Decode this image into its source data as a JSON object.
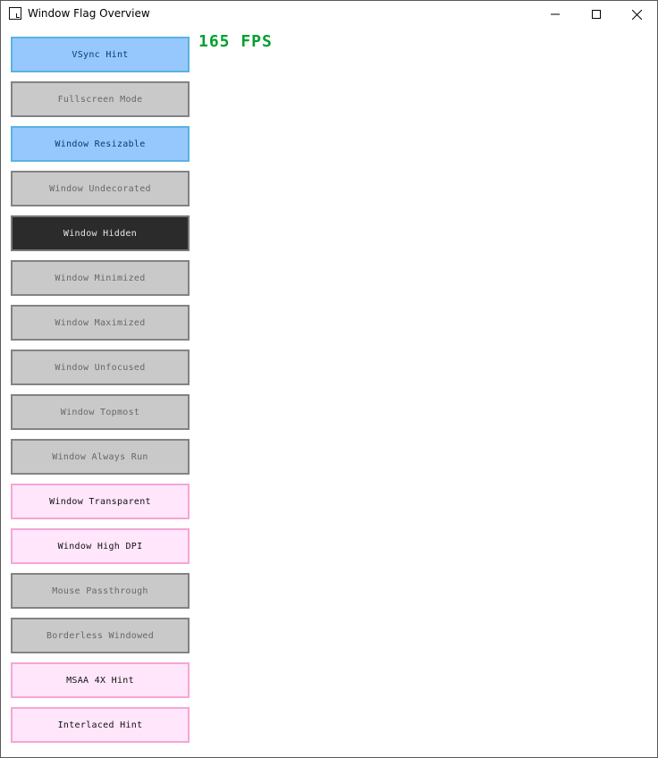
{
  "window": {
    "title": "Window Flag Overview"
  },
  "fps_label": "165 FPS",
  "colors": {
    "fps": "#00a02e",
    "button_off": "#c9c9c9",
    "button_on_blue": "#97c8fd",
    "button_on_pink": "#ffe6fb",
    "button_pressed": "#2b2b2b"
  },
  "flags": [
    {
      "label": "VSync Hint",
      "state": "on-blue"
    },
    {
      "label": "Fullscreen Mode",
      "state": "off"
    },
    {
      "label": "Window Resizable",
      "state": "on-blue"
    },
    {
      "label": "Window Undecorated",
      "state": "off"
    },
    {
      "label": "Window Hidden",
      "state": "pressed"
    },
    {
      "label": "Window Minimized",
      "state": "off"
    },
    {
      "label": "Window Maximized",
      "state": "off"
    },
    {
      "label": "Window Unfocused",
      "state": "off"
    },
    {
      "label": "Window Topmost",
      "state": "off"
    },
    {
      "label": "Window Always Run",
      "state": "off"
    },
    {
      "label": "Window Transparent",
      "state": "on-pink"
    },
    {
      "label": "Window High DPI",
      "state": "on-pink"
    },
    {
      "label": "Mouse Passthrough",
      "state": "off"
    },
    {
      "label": "Borderless Windowed",
      "state": "off"
    },
    {
      "label": "MSAA 4X Hint",
      "state": "on-pink"
    },
    {
      "label": "Interlaced Hint",
      "state": "on-pink"
    }
  ]
}
